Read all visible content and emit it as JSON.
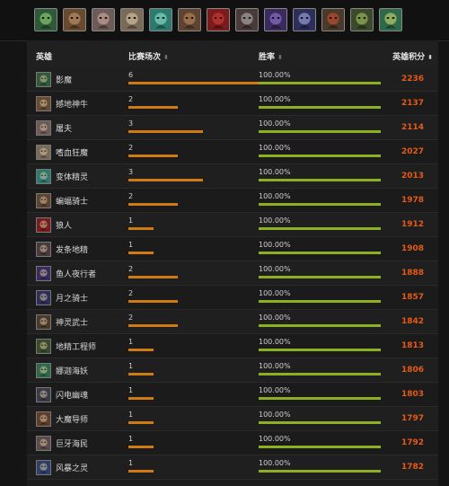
{
  "colors": {
    "background": "#141414",
    "match_bar": "#d07b12",
    "winrate_bar": "#8cb020",
    "score_text": "#e65a16"
  },
  "top_portraits": [
    {
      "icon": "shadow-demon-portrait-icon",
      "color": "#2f5a3a",
      "accent": "#9fe07a"
    },
    {
      "icon": "earthshaker-portrait-icon",
      "color": "#6a4a2e",
      "accent": "#c9a27a"
    },
    {
      "icon": "pudge-portrait-icon",
      "color": "#6e5a56",
      "accent": "#d9b4a8"
    },
    {
      "icon": "bloodseeker-portrait-icon",
      "color": "#7a6a58",
      "accent": "#e8d0b0"
    },
    {
      "icon": "morphling-portrait-icon",
      "color": "#2f7a6e",
      "accent": "#8ff0d8"
    },
    {
      "icon": "batrider-portrait-icon",
      "color": "#5e4430",
      "accent": "#c89060"
    },
    {
      "icon": "lycan-portrait-icon",
      "color": "#7a1c1c",
      "accent": "#e04040"
    },
    {
      "icon": "techies-portrait-icon",
      "color": "#4a3a3a",
      "accent": "#c0c0c0"
    },
    {
      "icon": "night-stalker-portrait-icon",
      "color": "#3a2a5e",
      "accent": "#a080e0"
    },
    {
      "icon": "luna-portrait-icon",
      "color": "#2e2e5a",
      "accent": "#b0b8f0"
    },
    {
      "icon": "juggernaut-portrait-icon",
      "color": "#4a3a2a",
      "accent": "#e05030"
    },
    {
      "icon": "tinker-portrait-icon",
      "color": "#3a4a2a",
      "accent": "#b0d060"
    },
    {
      "icon": "naga-siren-portrait-icon",
      "color": "#2e6a4a",
      "accent": "#e0e070"
    }
  ],
  "table": {
    "headers": {
      "hero": "英雄",
      "matches": "比赛场次",
      "matches_sort": "⬍",
      "winrate": "胜率",
      "winrate_sort": "⬍",
      "score": "英雄积分",
      "score_sort": "⬍"
    },
    "max_matches": 6,
    "rows": [
      {
        "name": "影魔",
        "matches": "6",
        "winrate": "100.00%",
        "winrate_fraction": 1.0,
        "score": "2236",
        "icon": "shadow-fiend-icon",
        "color": "#2f5a3a"
      },
      {
        "name": "撼地神牛",
        "matches": "2",
        "winrate": "100.00%",
        "winrate_fraction": 1.0,
        "score": "2137",
        "icon": "earthshaker-icon",
        "color": "#6a4a2e"
      },
      {
        "name": "屠夫",
        "matches": "3",
        "winrate": "100.00%",
        "winrate_fraction": 1.0,
        "score": "2114",
        "icon": "pudge-icon",
        "color": "#6e5a56"
      },
      {
        "name": "嗜血狂魔",
        "matches": "2",
        "winrate": "100.00%",
        "winrate_fraction": 1.0,
        "score": "2027",
        "icon": "bloodseeker-icon",
        "color": "#7a6a58"
      },
      {
        "name": "变体精灵",
        "matches": "3",
        "winrate": "100.00%",
        "winrate_fraction": 1.0,
        "score": "2013",
        "icon": "morphling-icon",
        "color": "#2f7a6e"
      },
      {
        "name": "蝙蝠骑士",
        "matches": "2",
        "winrate": "100.00%",
        "winrate_fraction": 1.0,
        "score": "1978",
        "icon": "batrider-icon",
        "color": "#5e4430"
      },
      {
        "name": "狼人",
        "matches": "1",
        "winrate": "100.00%",
        "winrate_fraction": 1.0,
        "score": "1912",
        "icon": "lycan-icon",
        "color": "#7a1c1c"
      },
      {
        "name": "发条地精",
        "matches": "1",
        "winrate": "100.00%",
        "winrate_fraction": 1.0,
        "score": "1908",
        "icon": "clockwerk-icon",
        "color": "#4a3a3a"
      },
      {
        "name": "鱼人夜行者",
        "matches": "2",
        "winrate": "100.00%",
        "winrate_fraction": 1.0,
        "score": "1888",
        "icon": "slark-icon",
        "color": "#3a2a5e"
      },
      {
        "name": "月之骑士",
        "matches": "2",
        "winrate": "100.00%",
        "winrate_fraction": 1.0,
        "score": "1857",
        "icon": "luna-icon",
        "color": "#2e2e5a"
      },
      {
        "name": "神灵武士",
        "matches": "2",
        "winrate": "100.00%",
        "winrate_fraction": 1.0,
        "score": "1842",
        "icon": "huskar-icon",
        "color": "#4a3a2a"
      },
      {
        "name": "地精工程师",
        "matches": "1",
        "winrate": "100.00%",
        "winrate_fraction": 1.0,
        "score": "1813",
        "icon": "techies-icon",
        "color": "#3a4a2a"
      },
      {
        "name": "娜迦海妖",
        "matches": "1",
        "winrate": "100.00%",
        "winrate_fraction": 1.0,
        "score": "1806",
        "icon": "naga-siren-icon",
        "color": "#2e6a4a"
      },
      {
        "name": "闪电幽魂",
        "matches": "1",
        "winrate": "100.00%",
        "winrate_fraction": 1.0,
        "score": "1803",
        "icon": "razor-icon",
        "color": "#3a3a48"
      },
      {
        "name": "大魔导师",
        "matches": "1",
        "winrate": "100.00%",
        "winrate_fraction": 1.0,
        "score": "1797",
        "icon": "invoker-icon",
        "color": "#5e3e2a"
      },
      {
        "name": "巨牙海民",
        "matches": "1",
        "winrate": "100.00%",
        "winrate_fraction": 1.0,
        "score": "1792",
        "icon": "tusk-icon",
        "color": "#5a4a4a"
      },
      {
        "name": "风暴之灵",
        "matches": "1",
        "winrate": "100.00%",
        "winrate_fraction": 1.0,
        "score": "1782",
        "icon": "storm-spirit-icon",
        "color": "#2e3e6a"
      }
    ]
  }
}
